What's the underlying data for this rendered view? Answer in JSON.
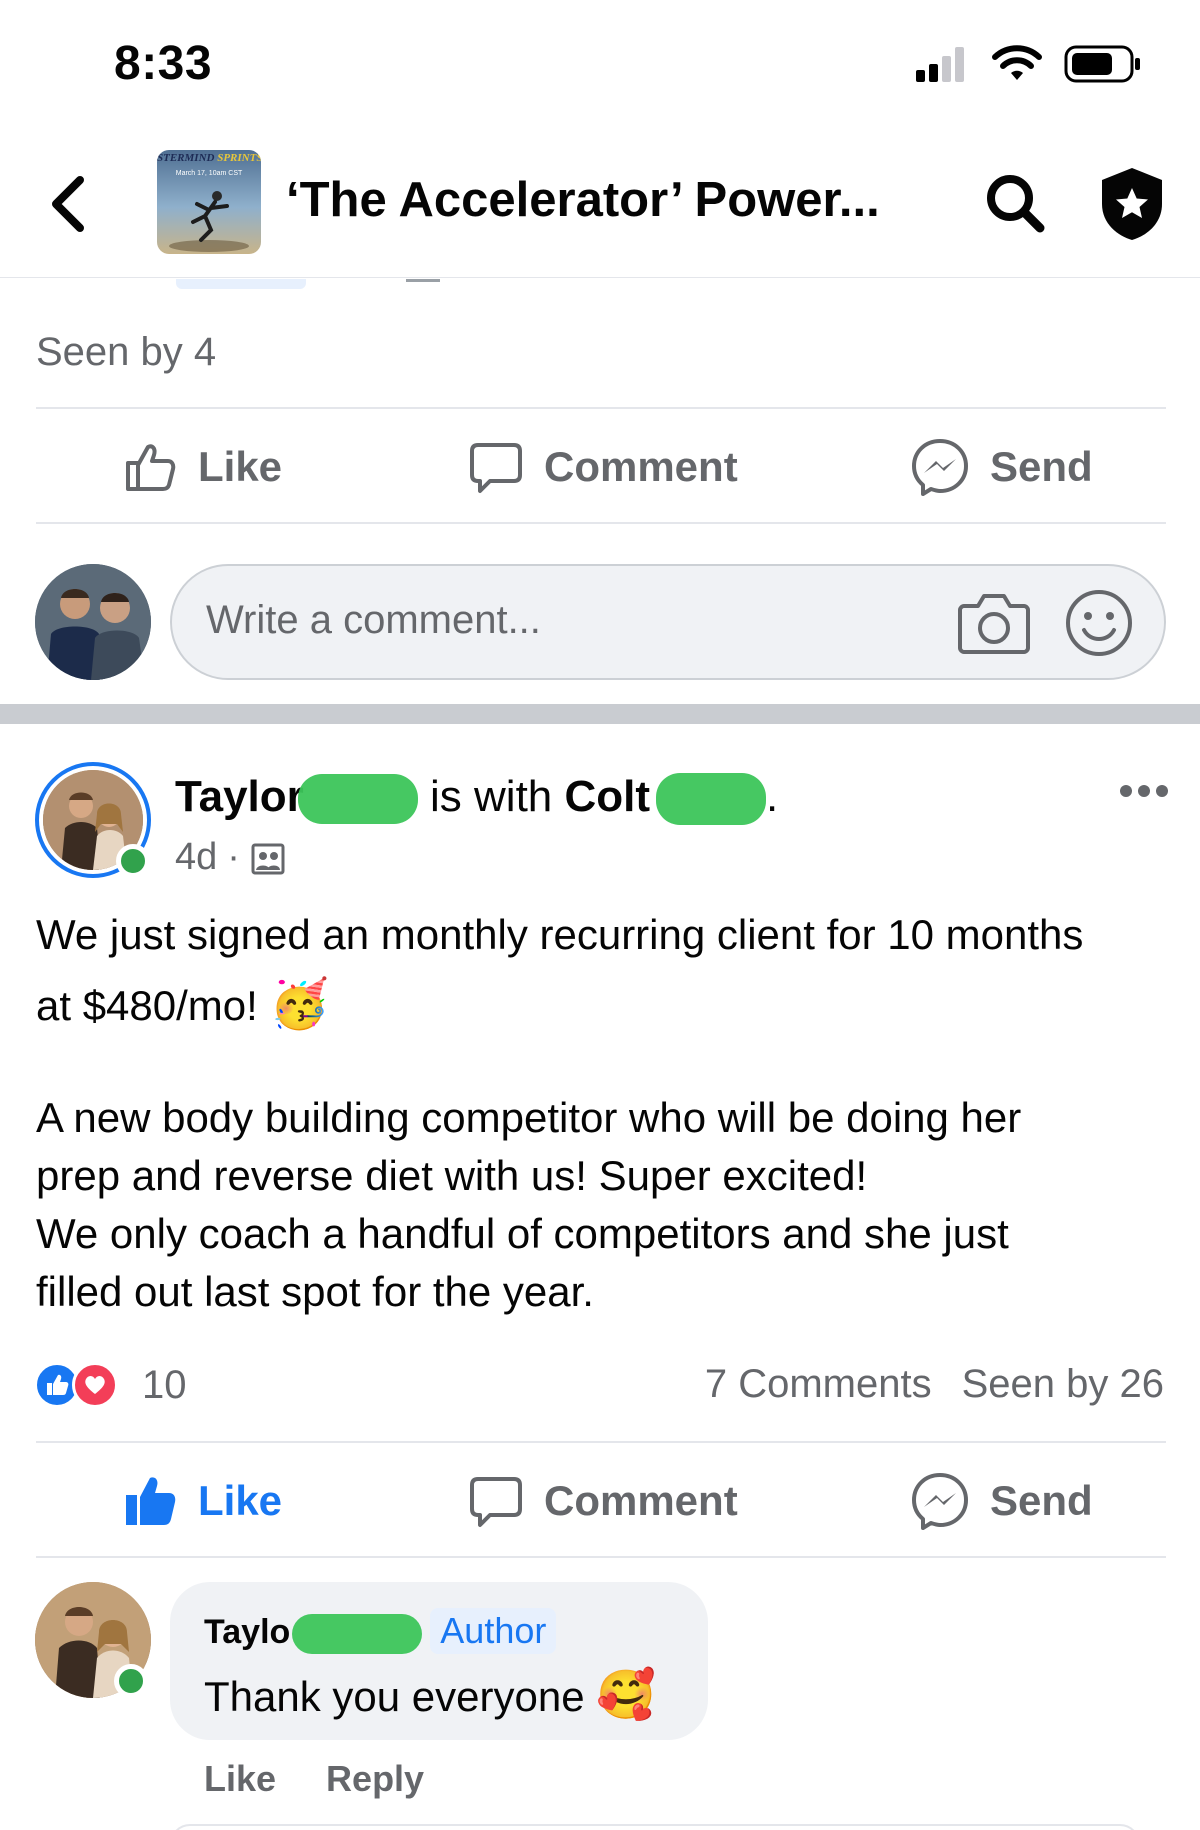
{
  "status_bar": {
    "time": "8:33"
  },
  "header": {
    "group_avatar_text": {
      "banner_a": "STERMIND",
      "banner_b": "SPRINTS",
      "sub": "March 17, 10am CST"
    },
    "title": "‘The Accelerator’ Power..."
  },
  "previous_post": {
    "seen_by": "Seen by 4",
    "actions": {
      "like": "Like",
      "comment": "Comment",
      "send": "Send"
    }
  },
  "composer": {
    "placeholder": "Write a comment..."
  },
  "post": {
    "author_first": "Taylor",
    "with_text": "is with",
    "tagged_first": "Colt",
    "trailing_period": ".",
    "time": "4d",
    "separator": "·",
    "body_line1": "We just signed an monthly recurring client for 10 months",
    "body_line2": "at $480/mo!",
    "body_emoji": "🥳",
    "body_para2_l1": "A new body building competitor who will be doing her",
    "body_para2_l2": "prep and reverse diet with us! Super excited!",
    "body_para2_l3": "We only coach a handful of competitors and she just",
    "body_para2_l4": "filled out last spot for the year.",
    "reaction_count": "10",
    "comments_count": "7 Comments",
    "seen_by": "Seen by 26",
    "actions": {
      "like": "Like",
      "comment": "Comment",
      "send": "Send"
    },
    "like_state": "liked"
  },
  "reply": {
    "author_first": "Taylo",
    "badge": "Author",
    "text": "Thank you everyone",
    "emoji": "🥰",
    "actions": {
      "like": "Like",
      "reply": "Reply"
    }
  },
  "colors": {
    "facebook_blue": "#1877f2",
    "secondary_text": "#65676b",
    "online_green": "#31a24c",
    "love_red": "#f33e58"
  }
}
